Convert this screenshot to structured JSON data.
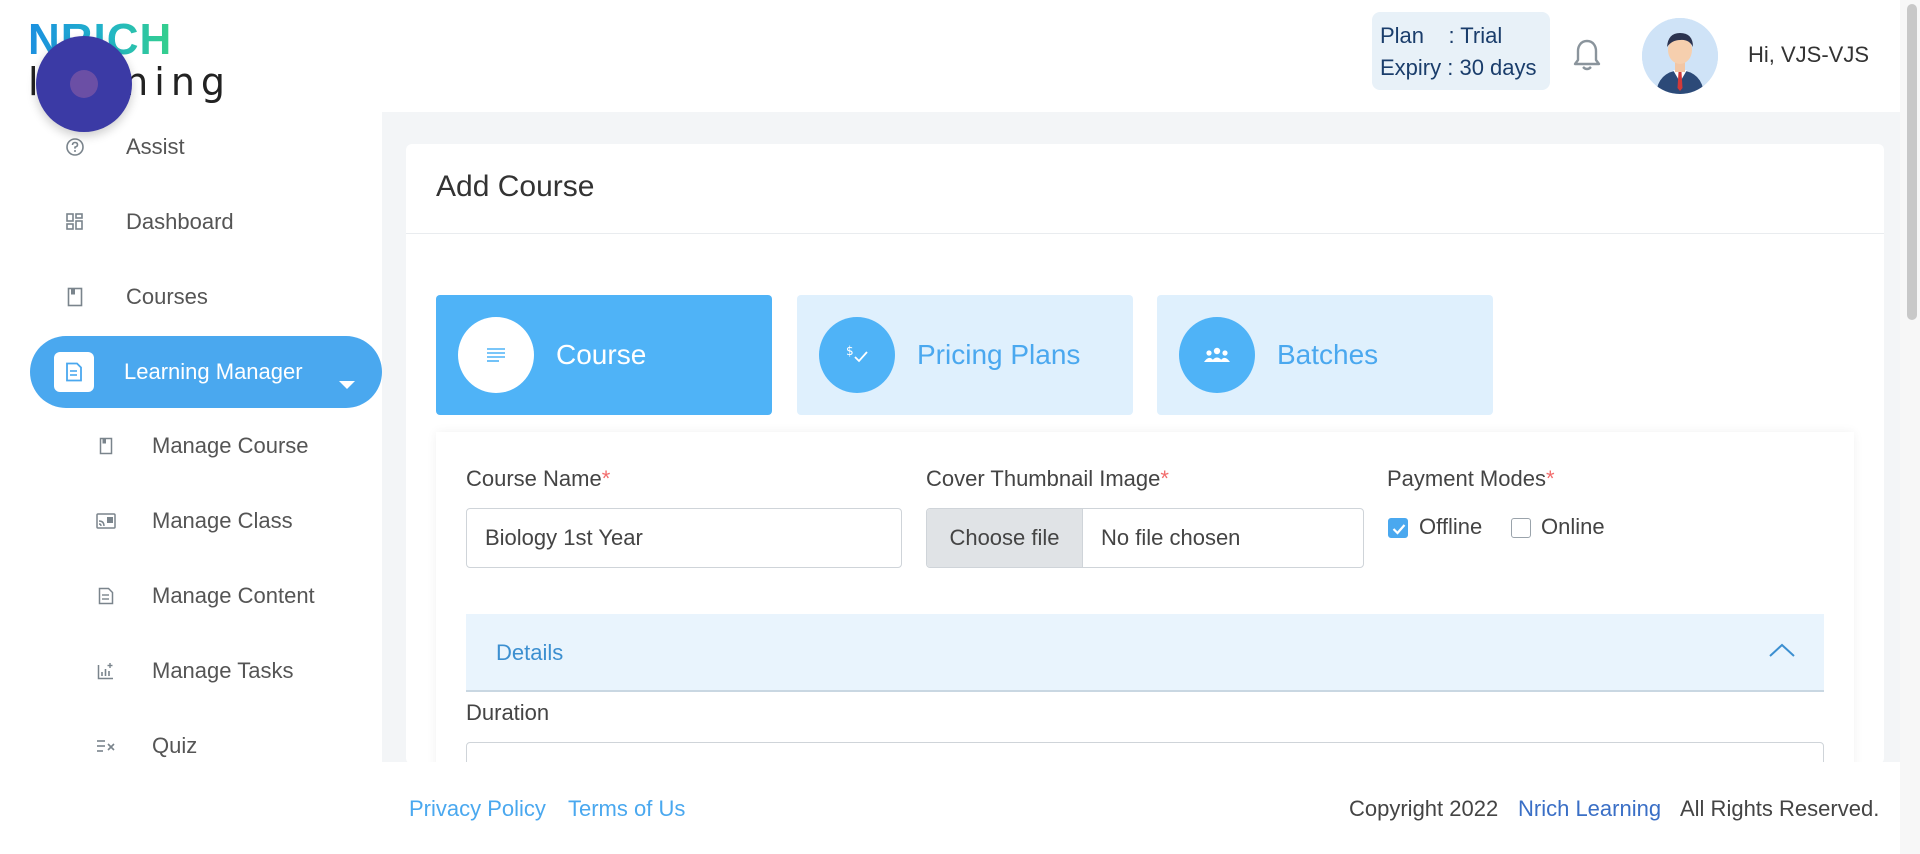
{
  "brand": {
    "logo_top": "NRICH",
    "logo_bottom": "learning"
  },
  "header": {
    "plan_line": "Plan    : Trial",
    "expiry_line": "Expiry : 30 days",
    "greeting": "Hi, VJS-VJS",
    "bell_icon": "bell-icon"
  },
  "sidebar": {
    "items": [
      {
        "label": "Assist",
        "icon": "help-circle-icon"
      },
      {
        "label": "Dashboard",
        "icon": "dashboard-grid-icon"
      },
      {
        "label": "Courses",
        "icon": "book-icon"
      },
      {
        "label": "Learning Manager",
        "icon": "document-icon",
        "active": true
      }
    ],
    "sub_items": [
      {
        "label": "Manage Course",
        "icon": "book-icon"
      },
      {
        "label": "Manage Class",
        "icon": "cast-icon"
      },
      {
        "label": "Manage Content",
        "icon": "document-icon"
      },
      {
        "label": "Manage Tasks",
        "icon": "chart-add-icon"
      },
      {
        "label": "Quiz",
        "icon": "list-check-icon"
      }
    ]
  },
  "page": {
    "title": "Add Course"
  },
  "steps": [
    {
      "label": "Course",
      "icon": "lines-icon",
      "active": true
    },
    {
      "label": "Pricing Plans",
      "icon": "dollar-check-icon",
      "active": false
    },
    {
      "label": "Batches",
      "icon": "group-icon",
      "active": false
    }
  ],
  "form": {
    "course_name_label": "Course Name",
    "course_name_value": "Biology 1st Year",
    "thumbnail_label": "Cover Thumbnail Image",
    "choose_file_label": "Choose file",
    "no_file_text": "No file chosen",
    "payment_modes_label": "Payment Modes",
    "payment_options": [
      {
        "label": "Offline",
        "checked": true
      },
      {
        "label": "Online",
        "checked": false
      }
    ],
    "required_mark": "*",
    "details_label": "Details",
    "duration_label": "Duration"
  },
  "footer": {
    "privacy": "Privacy Policy",
    "terms": "Terms of Us",
    "copyright": "Copyright 2022",
    "brand_link": "Nrich Learning",
    "rights": "All Rights Reserved."
  },
  "colors": {
    "accent": "#4aa8ef",
    "step_active": "#4fb3f7",
    "step_inactive_bg": "#dff0fd",
    "required": "#f26c6c"
  }
}
